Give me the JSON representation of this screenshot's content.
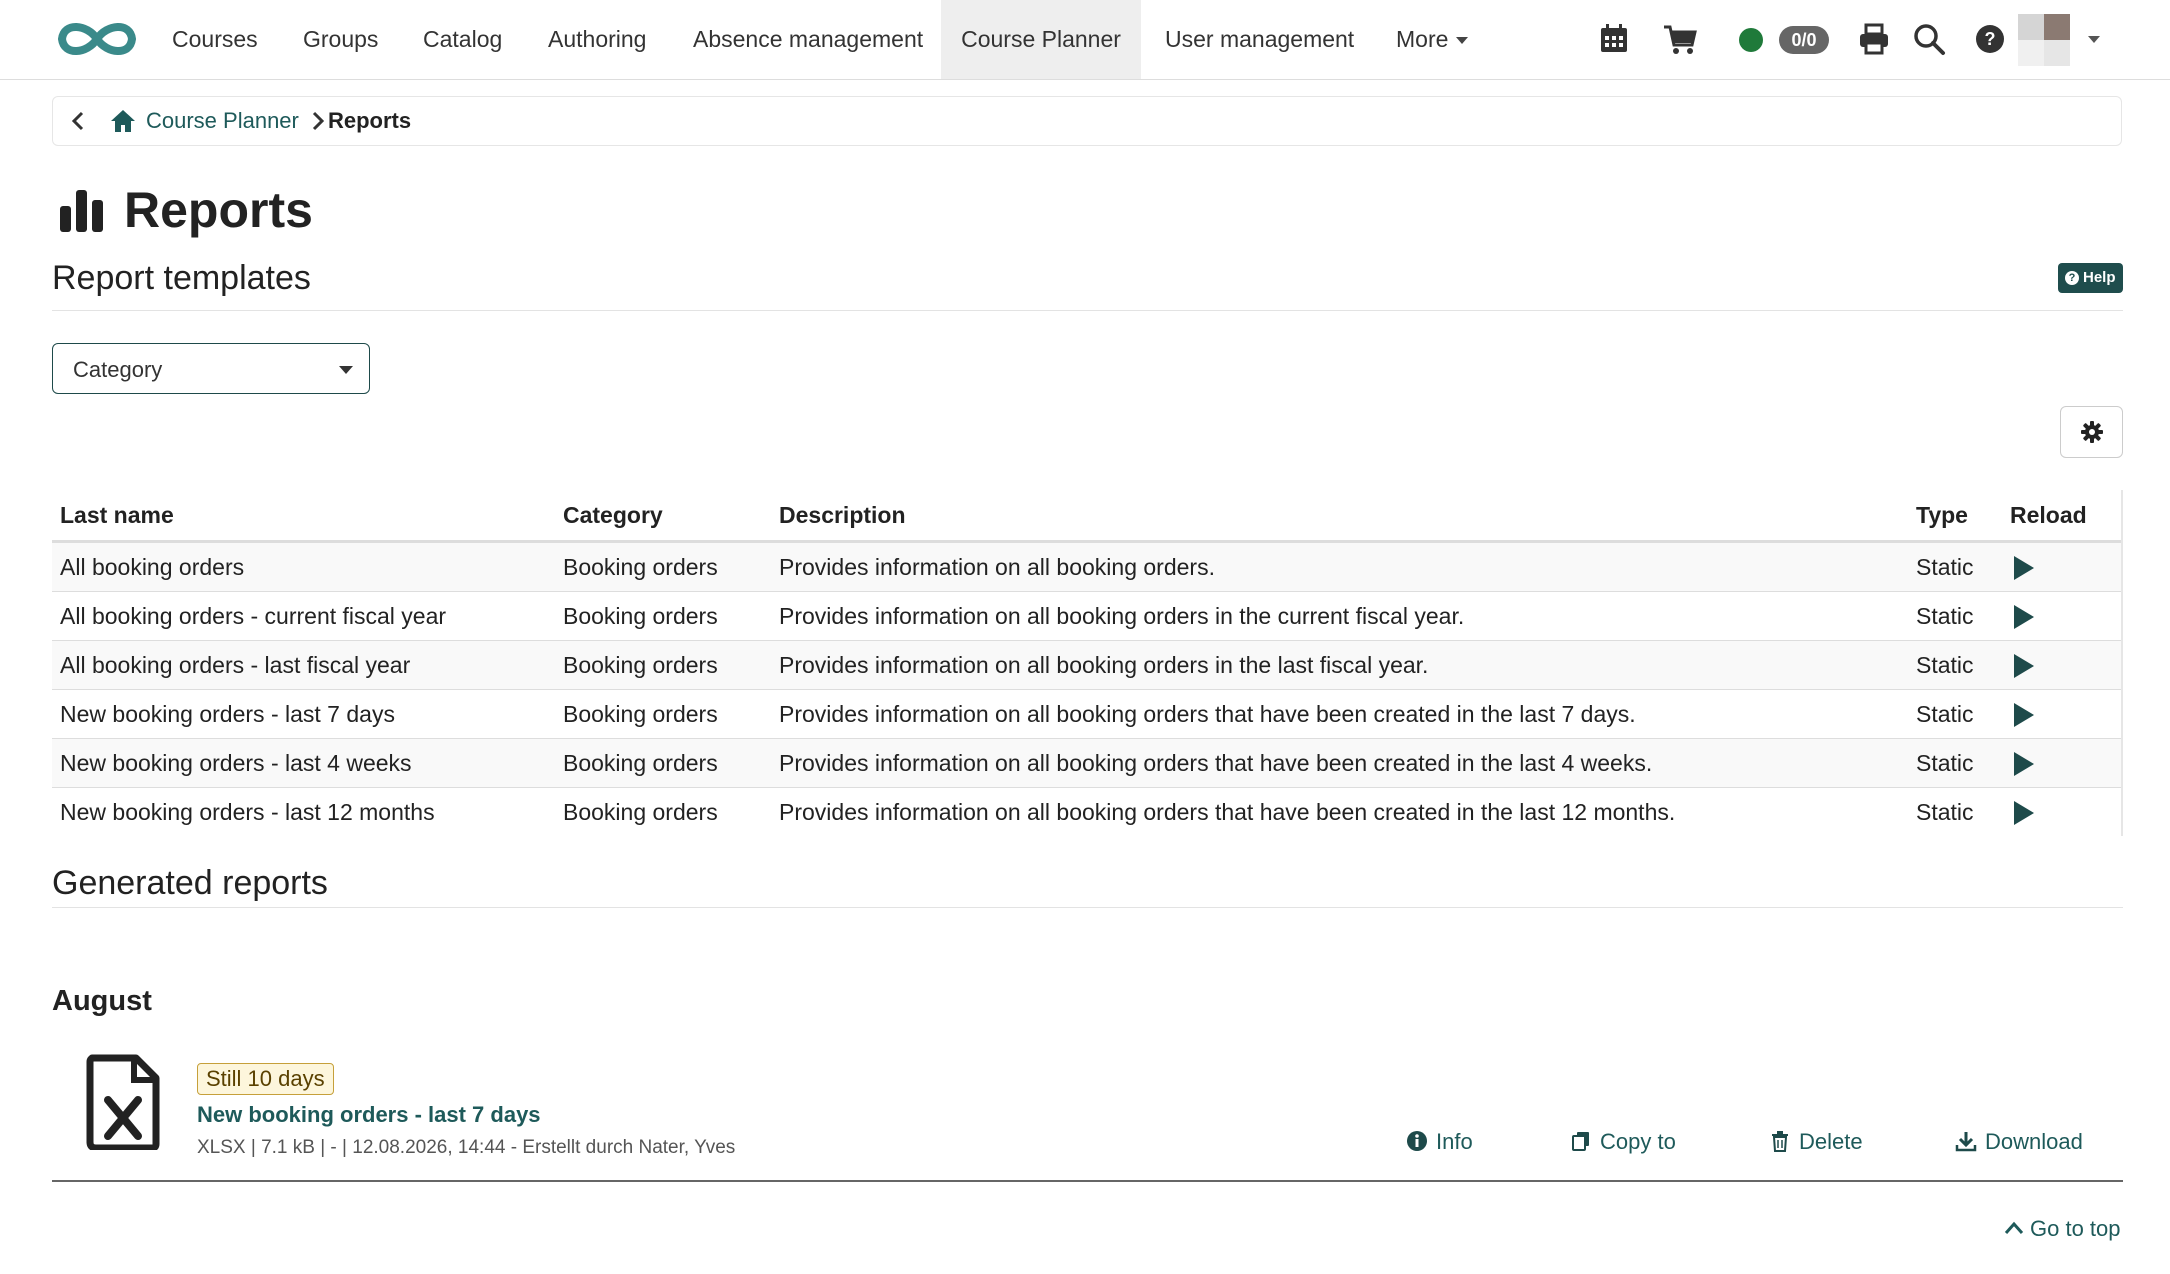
{
  "nav": {
    "items": [
      "Courses",
      "Groups",
      "Catalog",
      "Authoring",
      "Absence management",
      "Course Planner",
      "User management"
    ],
    "more_label": "More",
    "active": "Course Planner",
    "status_count": "0/0"
  },
  "breadcrumb": {
    "link": "Course Planner",
    "current": "Reports"
  },
  "page": {
    "title": "Reports",
    "templates_heading": "Report templates",
    "help_label": "Help",
    "category_filter": "Category"
  },
  "table": {
    "columns": [
      "Last name",
      "Category",
      "Description",
      "Type",
      "Reload"
    ],
    "rows": [
      {
        "name": "All booking orders",
        "category": "Booking orders",
        "description": "Provides information on all booking orders.",
        "type": "Static"
      },
      {
        "name": "All booking orders - current fiscal year",
        "category": "Booking orders",
        "description": "Provides information on all booking orders in the current fiscal year.",
        "type": "Static"
      },
      {
        "name": "All booking orders - last fiscal year",
        "category": "Booking orders",
        "description": "Provides information on all booking orders in the last fiscal year.",
        "type": "Static"
      },
      {
        "name": "New booking orders - last 7 days",
        "category": "Booking orders",
        "description": "Provides information on all booking orders that have been created in the last 7 days.",
        "type": "Static"
      },
      {
        "name": "New booking orders - last 4 weeks",
        "category": "Booking orders",
        "description": "Provides information on all booking orders that have been created in the last 4 weeks.",
        "type": "Static"
      },
      {
        "name": "New booking orders - last 12 months",
        "category": "Booking orders",
        "description": "Provides information on all booking orders that have been created in the last 12 months.",
        "type": "Static"
      }
    ]
  },
  "generated": {
    "heading": "Generated reports",
    "month": "August",
    "report": {
      "badge": "Still 10 days",
      "title": "New booking orders - last 7 days",
      "meta": "XLSX | 7.1 kB | - | 12.08.2026, 14:44 - Erstellt durch Nater, Yves",
      "actions": {
        "info": "Info",
        "copy": "Copy to",
        "delete": "Delete",
        "download": "Download"
      }
    }
  },
  "footer": {
    "go_top": "Go to top"
  },
  "colors": {
    "brand": "#1e5a5a",
    "logo": "#3a8a8a",
    "status_online": "#1f7a3a"
  },
  "icons": [
    "logo",
    "calendar-icon",
    "cart-icon",
    "printer-icon",
    "search-icon",
    "help-icon",
    "home-icon",
    "bar-chart-icon",
    "gear-icon",
    "play-icon",
    "excel-file-icon",
    "info-icon",
    "copy-icon",
    "trash-icon",
    "download-icon",
    "chevron-up-icon"
  ]
}
